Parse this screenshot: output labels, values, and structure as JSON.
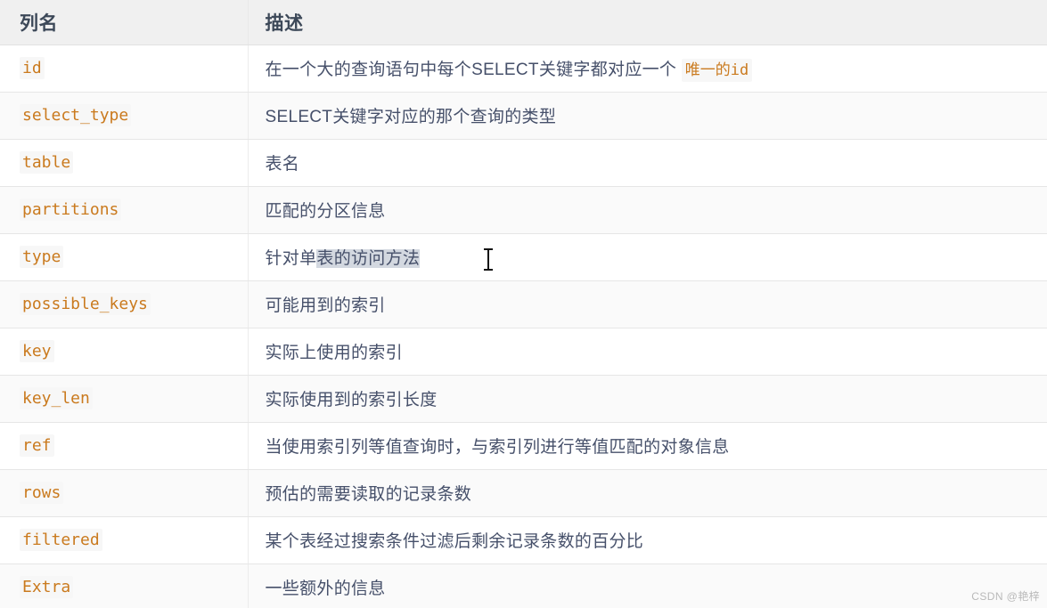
{
  "table": {
    "headers": {
      "name": "列名",
      "description": "描述"
    },
    "rows": [
      {
        "name": "id",
        "desc_prefix": "在一个大的查询语句中每个SELECT关键字都对应一个 ",
        "desc_code": "唯一的id",
        "desc_suffix": ""
      },
      {
        "name": "select_type",
        "desc_prefix": "SELECT关键字对应的那个查询的类型",
        "desc_code": "",
        "desc_suffix": ""
      },
      {
        "name": "table",
        "desc_prefix": "表名",
        "desc_code": "",
        "desc_suffix": ""
      },
      {
        "name": "partitions",
        "desc_prefix": "匹配的分区信息",
        "desc_code": "",
        "desc_suffix": ""
      },
      {
        "name": "type",
        "desc_prefix": "针对单",
        "desc_selected": "表的访问方法 ",
        "desc_code": "",
        "desc_suffix": ""
      },
      {
        "name": "possible_keys",
        "desc_prefix": "可能用到的索引",
        "desc_code": "",
        "desc_suffix": ""
      },
      {
        "name": "key",
        "desc_prefix": "实际上使用的索引",
        "desc_code": "",
        "desc_suffix": ""
      },
      {
        "name": "key_len",
        "desc_prefix": "实际使用到的索引长度",
        "desc_code": "",
        "desc_suffix": ""
      },
      {
        "name": "ref",
        "desc_prefix": "当使用索引列等值查询时，与索引列进行等值匹配的对象信息",
        "desc_code": "",
        "desc_suffix": ""
      },
      {
        "name": "rows",
        "desc_prefix": "预估的需要读取的记录条数",
        "desc_code": "",
        "desc_suffix": ""
      },
      {
        "name": "filtered",
        "desc_prefix": "某个表经过搜索条件过滤后剩余记录条数的百分比",
        "desc_code": "",
        "desc_suffix": ""
      },
      {
        "name": "Extra",
        "desc_prefix": "一些额外的信息",
        "desc_code": "",
        "desc_suffix": ""
      }
    ]
  },
  "watermark": "CSDN @艳梓",
  "colors": {
    "header_bg": "#f0f0f0",
    "header_text": "#3c4858",
    "body_text": "#46506a",
    "code_text": "#ca7a1e",
    "code_bg": "#f7f7f7",
    "row_alt_bg": "#fafafa",
    "selection_bg": "#d3d8e0",
    "border": "#e6e6e6"
  }
}
